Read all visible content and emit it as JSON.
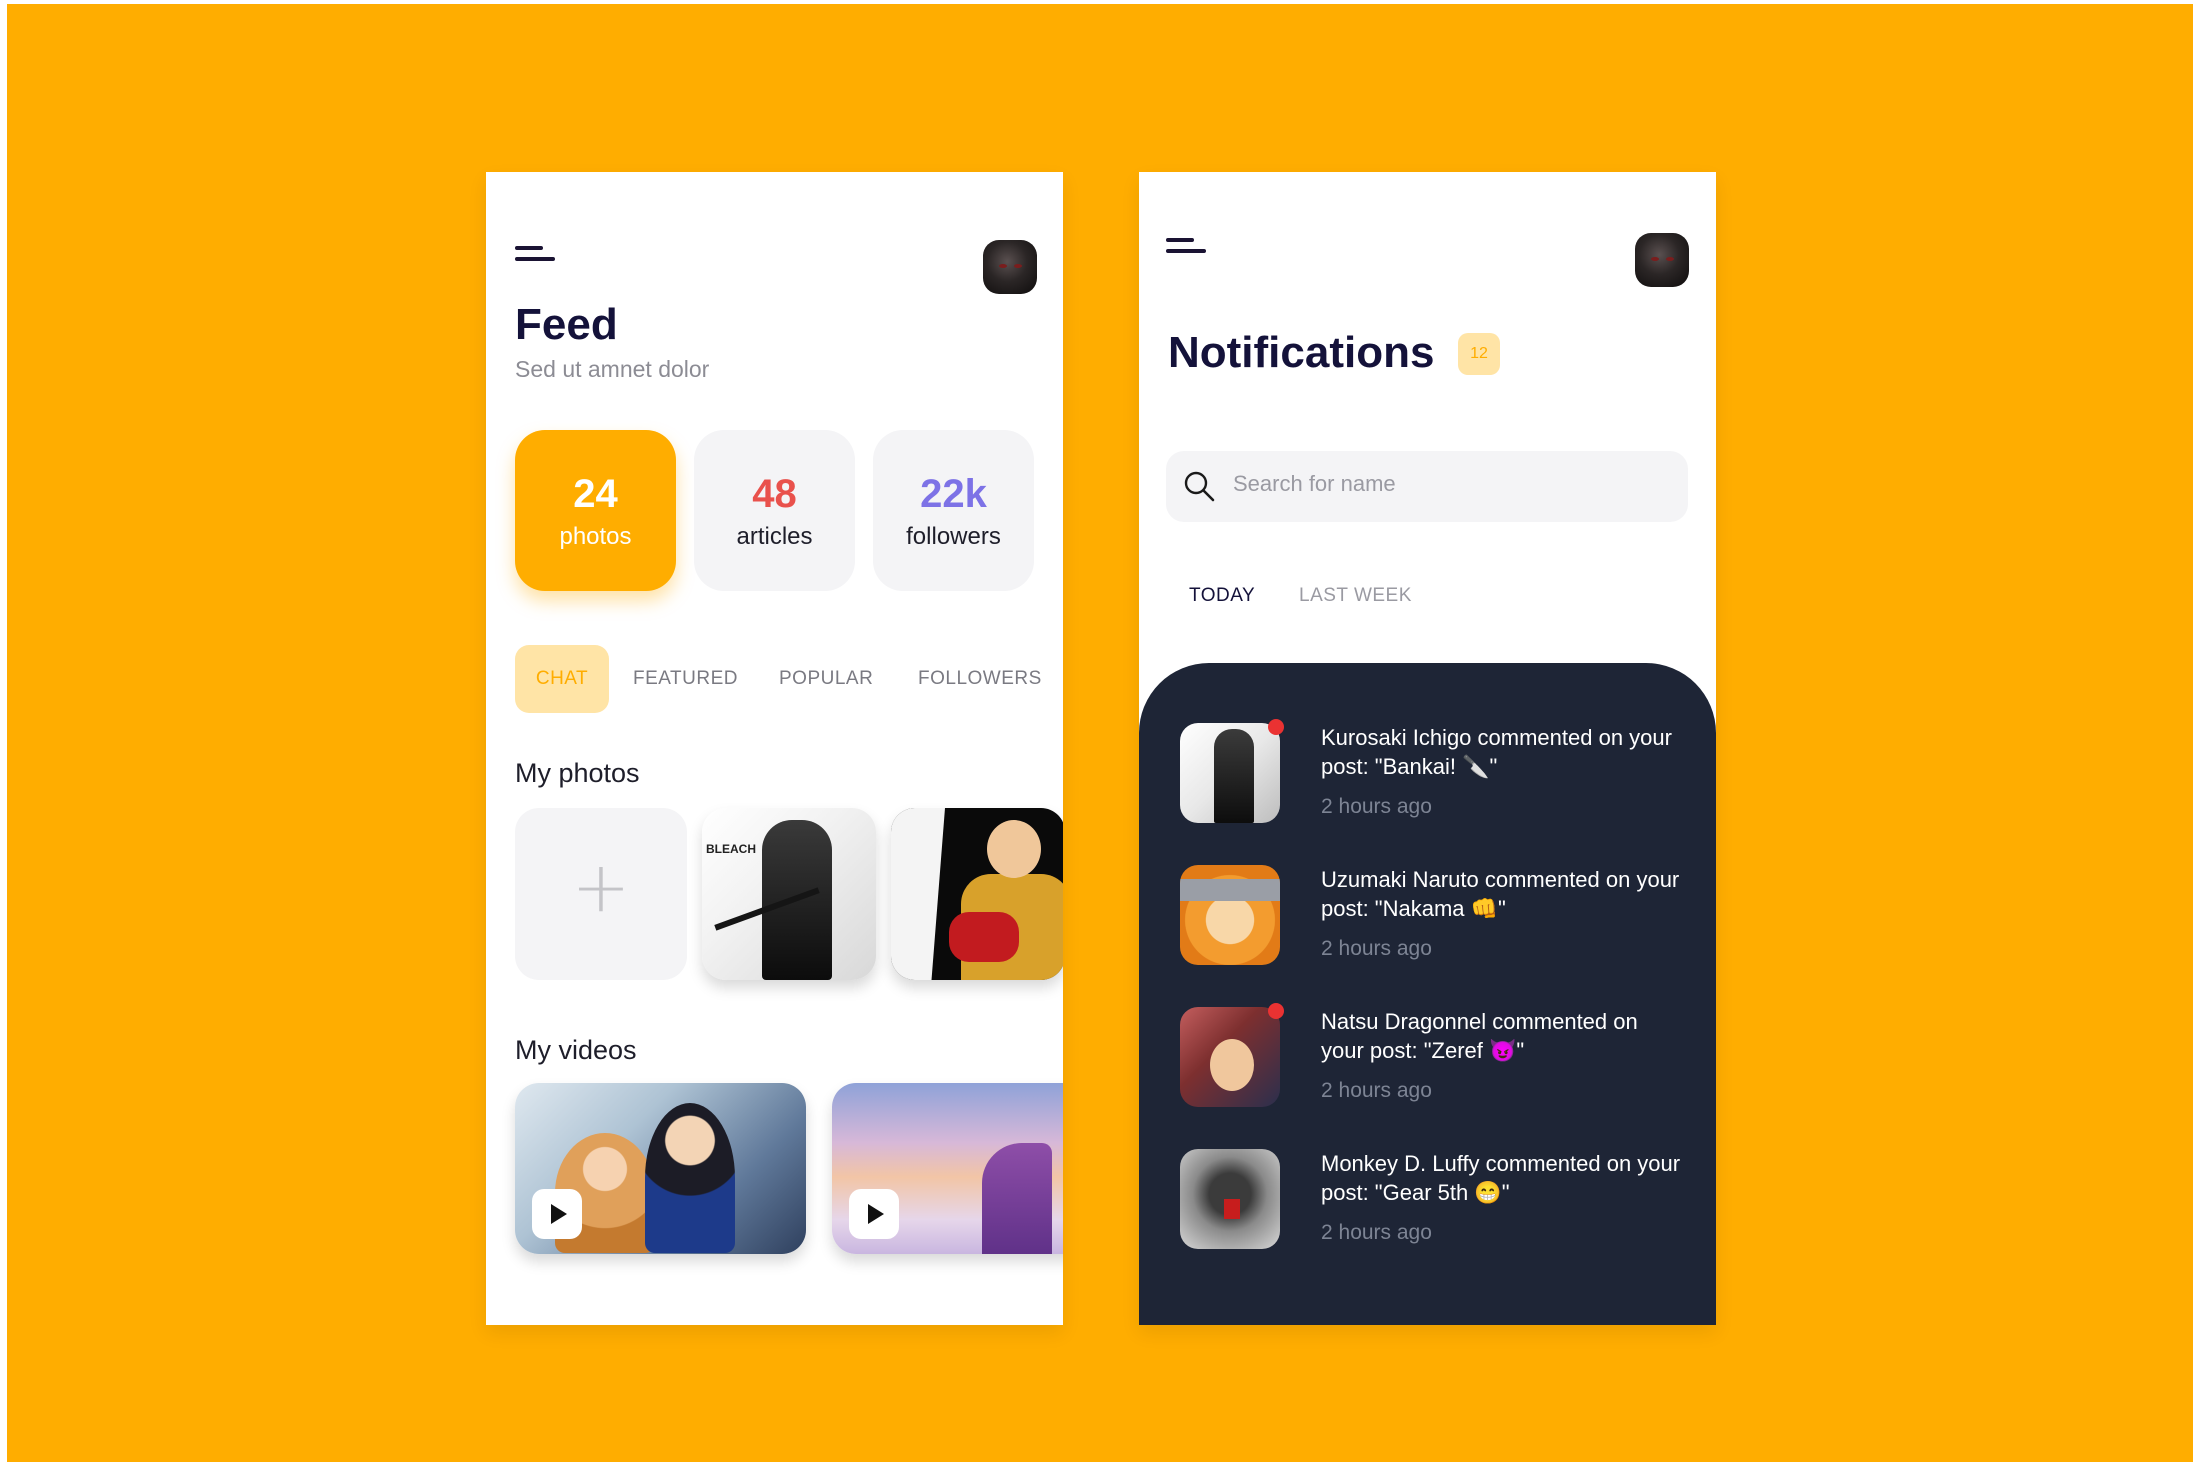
{
  "feed": {
    "title": "Feed",
    "subtitle": "Sed ut amnet dolor",
    "stats": [
      {
        "value": "24",
        "label": "photos"
      },
      {
        "value": "48",
        "label": "articles"
      },
      {
        "value": "22k",
        "label": "followers"
      }
    ],
    "tabs": [
      "CHAT",
      "FEATURED",
      "POPULAR",
      "FOLLOWERS"
    ],
    "active_tab": "CHAT",
    "photos_heading": "My photos",
    "add_symbol": "+",
    "videos_heading": "My videos",
    "bleach_logo": "BLEACH"
  },
  "notifications": {
    "title": "Notifications",
    "badge_count": "12",
    "search_placeholder": "Search for name",
    "tabs": [
      "TODAY",
      "LAST WEEK"
    ],
    "active_tab": "TODAY",
    "items": [
      {
        "text": "Kurosaki Ichigo commented on your post: \"Bankai! 🔪\"",
        "time": "2 hours ago",
        "unread": true
      },
      {
        "text": "Uzumaki Naruto commented on your post: \"Nakama 👊\"",
        "time": "2 hours ago",
        "unread": false
      },
      {
        "text": "Natsu Dragonnel commented on your post: \"Zeref 😈\"",
        "time": "2 hours ago",
        "unread": true
      },
      {
        "text": "Monkey D. Luffy commented on your post: \"Gear 5th 😁\"",
        "time": "2 hours ago",
        "unread": false
      }
    ]
  },
  "colors": {
    "background": "#FFAD00",
    "accent": "#FFAD00",
    "articles": "#e9514c",
    "followers": "#7d72e6",
    "panel": "#1E2536",
    "title": "#14123a",
    "unread_dot": "#ea3232"
  },
  "icons": [
    "menu-icon",
    "search-icon",
    "play-icon",
    "plus-icon"
  ]
}
